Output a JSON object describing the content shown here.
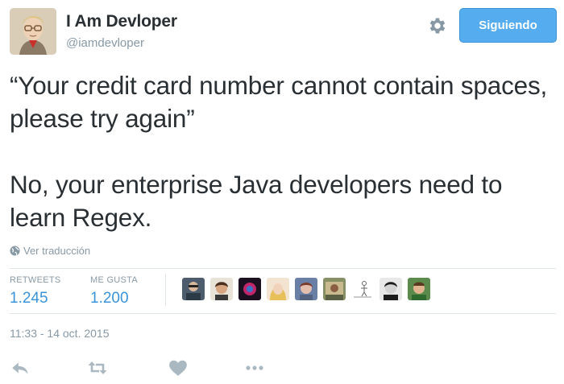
{
  "header": {
    "display_name": "I Am Devloper",
    "screen_name": "@iamdevloper",
    "follow_label": "Siguiendo",
    "avatar_icon": "user-avatar-icon",
    "gear_icon": "gear-icon"
  },
  "tweet": {
    "paragraphs": [
      "“Your credit card number cannot contain spaces, please try again”",
      "No, your enterprise Java developers need to learn Regex."
    ],
    "translate_label": "Ver traducción",
    "timestamp": "11:33 - 14 oct. 2015"
  },
  "stats": {
    "retweets_label": "RETWEETS",
    "retweets_count": "1.245",
    "likes_label": "ME GUSTA",
    "likes_count": "1.200",
    "likers_shown": 9
  },
  "actions": [
    "reply-icon",
    "retweet-icon",
    "like-heart-icon",
    "more-options-icon"
  ],
  "colors": {
    "accent": "#55acee",
    "link_blue": "#3b94d9",
    "muted": "#8899a6",
    "text": "#292f33",
    "divider": "#e1e8ed"
  }
}
